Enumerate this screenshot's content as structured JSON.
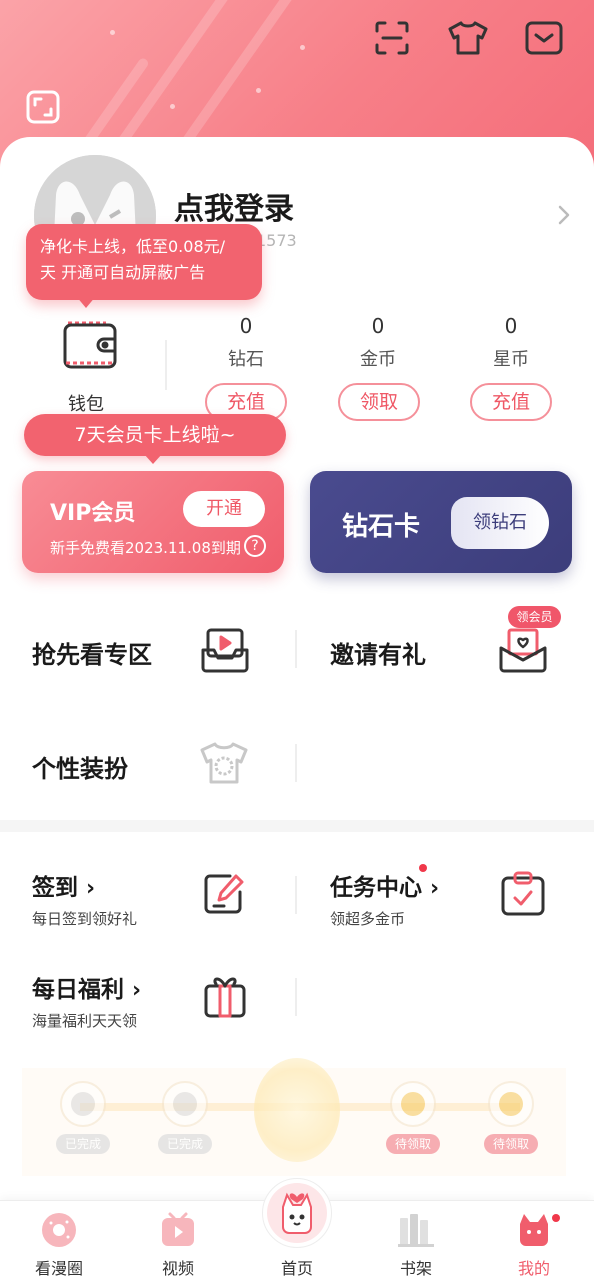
{
  "header": {
    "icons": [
      "scan-icon",
      "outfit-icon",
      "message-icon",
      "fullscreen-icon"
    ]
  },
  "profile": {
    "login_text": "点我登录",
    "user_id_partial": "1573"
  },
  "tooltips": {
    "purify_card_line1": "净化卡上线，低至0.08元/",
    "purify_card_line2": "天 开通可自动屏蔽广告",
    "vip_card_tip": "7天会员卡上线啦~"
  },
  "wallet": {
    "label": "钱包",
    "stats": [
      {
        "value": "0",
        "label": "钻石",
        "button": "充值"
      },
      {
        "value": "0",
        "label": "金币",
        "button": "领取"
      },
      {
        "value": "0",
        "label": "星币",
        "button": "充值"
      }
    ]
  },
  "vip": {
    "title": "VIP会员",
    "open_button": "开通",
    "subtitle": "新手免费看2023.11.08到期",
    "help": "?"
  },
  "diamond_card": {
    "title": "钻石卡",
    "button": "领钻石"
  },
  "features": {
    "early_access": "抢先看专区",
    "invite": "邀请有礼",
    "invite_badge": "领会员",
    "dress_up": "个性装扮"
  },
  "tasks": {
    "checkin": {
      "title": "签到",
      "sub": "每日签到领好礼"
    },
    "task_center": {
      "title": "任务中心",
      "sub": "领超多金币"
    },
    "daily_welfare": {
      "title": "每日福利",
      "sub": "海量福利天天领"
    }
  },
  "progress": {
    "tags": [
      "已完成",
      "已完成",
      "待领取",
      "待领取"
    ]
  },
  "nav": {
    "items": [
      "看漫圈",
      "视频",
      "首页",
      "书架",
      "我的"
    ]
  },
  "colors": {
    "brand_pink": "#f2636f",
    "diamond_purple": "#3c3d7b"
  }
}
